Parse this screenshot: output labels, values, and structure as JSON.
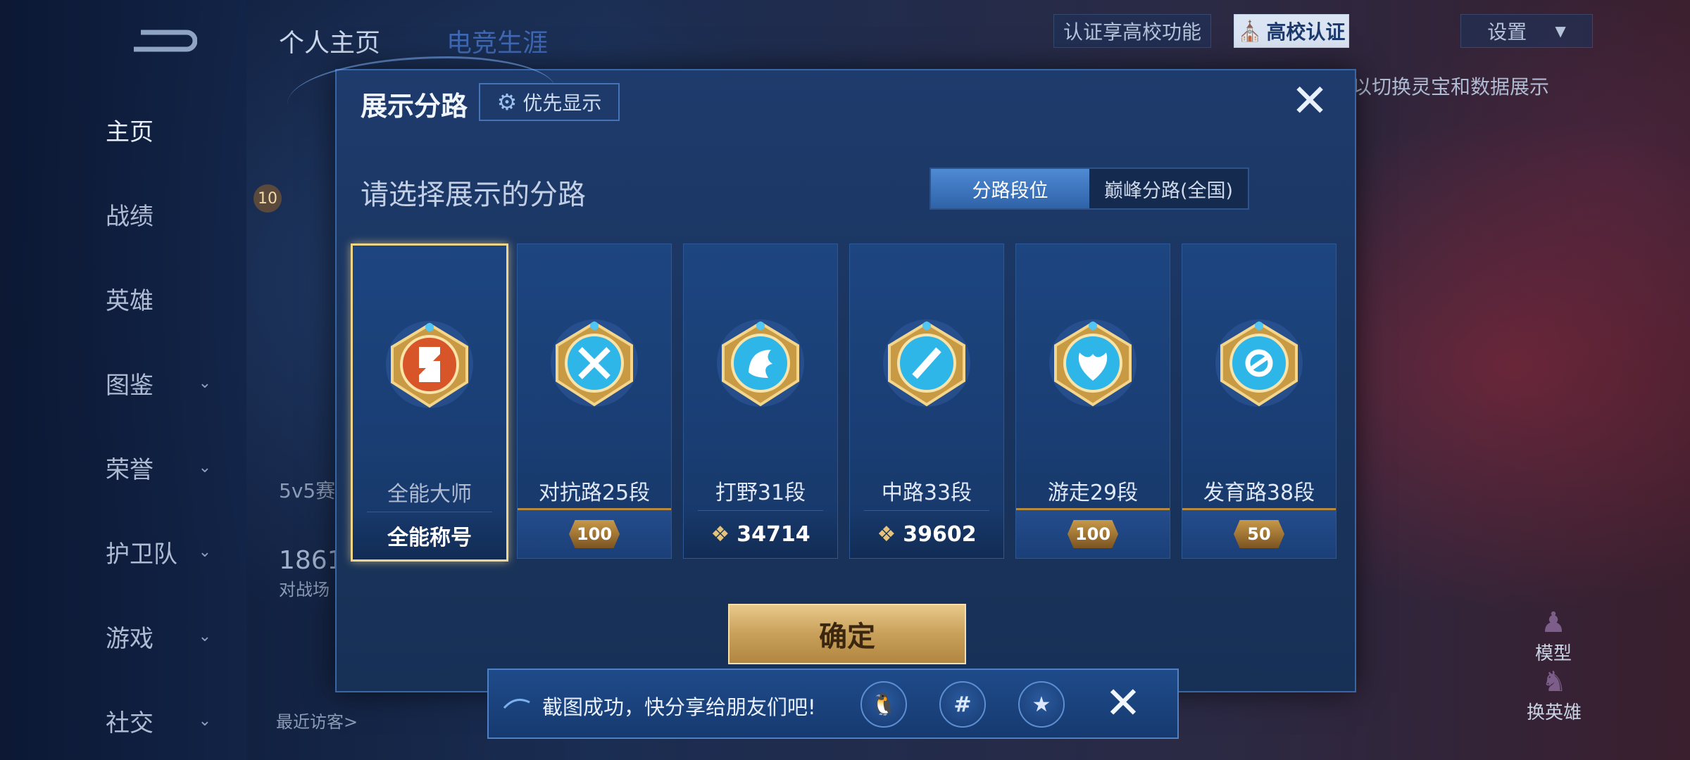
{
  "background": {
    "nav": [
      {
        "label": "主页",
        "active": true,
        "chevron": false
      },
      {
        "label": "战绩",
        "active": false,
        "chevron": false
      },
      {
        "label": "英雄",
        "active": false,
        "chevron": false
      },
      {
        "label": "图鉴",
        "active": false,
        "chevron": true
      },
      {
        "label": "荣誉",
        "active": false,
        "chevron": true
      },
      {
        "label": "护卫队",
        "active": false,
        "chevron": true
      },
      {
        "label": "游戏",
        "active": false,
        "chevron": true
      },
      {
        "label": "社交",
        "active": false,
        "chevron": true
      }
    ],
    "tabs": [
      "个人主页",
      "电竞生涯"
    ],
    "certify_text": "认证享高校功能",
    "campus_btn": "高校认证",
    "settings_btn": "设置",
    "hint_text": "以切换灵宝和数据展示",
    "level_badge": "10",
    "mode_label": "5v5赛",
    "count_text": "1861",
    "count_sub": "对战场",
    "visitors": "最近访客>",
    "model_btn": "模型",
    "swap_btn": "换英雄"
  },
  "dialog": {
    "title": "展示分路",
    "priority_btn": "优先显示",
    "subtitle": "请选择展示的分路",
    "toggle": {
      "selected": "分路段位",
      "other": "巅峰分路(全国)"
    },
    "confirm": "确定",
    "cards": [
      {
        "label": "全能大师",
        "foot_text": "全能称号",
        "foot_type": "plain",
        "selected": true,
        "emblem": "all-round-emblem-icon"
      },
      {
        "label": "对抗路25段",
        "badge": "100",
        "foot_type": "banner",
        "selected": false,
        "emblem": "clash-lane-emblem-icon"
      },
      {
        "label": "打野31段",
        "score": "34714",
        "foot_type": "score",
        "selected": false,
        "emblem": "jungle-emblem-icon"
      },
      {
        "label": "中路33段",
        "score": "39602",
        "foot_type": "score",
        "selected": false,
        "emblem": "mid-lane-emblem-icon"
      },
      {
        "label": "游走29段",
        "badge": "100",
        "foot_type": "banner",
        "selected": false,
        "emblem": "roam-emblem-icon"
      },
      {
        "label": "发育路38段",
        "badge": "50",
        "foot_type": "banner",
        "selected": false,
        "emblem": "farm-lane-emblem-icon"
      }
    ]
  },
  "toast": {
    "text": "截图成功，快分享给朋友们吧!"
  },
  "colors": {
    "gold": "#f0d48a",
    "panel": "#1e3b6d",
    "accent": "#4f8ad4"
  }
}
